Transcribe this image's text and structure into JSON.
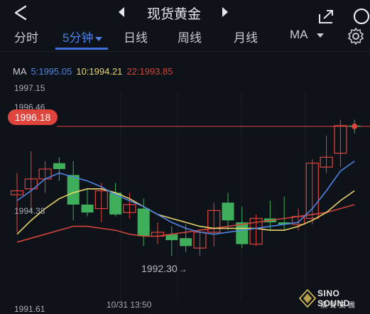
{
  "header": {
    "title": "现货黄金"
  },
  "tabs": [
    {
      "label": "分时"
    },
    {
      "label": "5分钟"
    },
    {
      "label": "日线"
    },
    {
      "label": "周线"
    },
    {
      "label": "月线"
    },
    {
      "label": "MA"
    }
  ],
  "ma_legend": {
    "ma_prefix": "MA",
    "ma5": "5:1995.05",
    "ma10": "10:1994.21",
    "ma22": "22:1993.85"
  },
  "y_axis_labels": {
    "top": "1997.15",
    "upper": "1996.46",
    "mid": "1994.38",
    "bottom": "1991.61"
  },
  "current_price": "1996.18",
  "low_annotation": "1992.30",
  "x_axis_label": "10/31 13:50",
  "logo": {
    "line1": "SINO SOUND",
    "line2": "漢聲集團"
  },
  "colors": {
    "up": "#e0453d",
    "down": "#3fae5a",
    "ma5": "#4f84e0",
    "ma10": "#e8d46a",
    "ma22": "#d0443a",
    "active_tab": "#4f7fe6"
  },
  "chart_data": {
    "type": "candlestick",
    "ylim": [
      1991.61,
      1997.15
    ],
    "candles": [
      {
        "o": 1994.45,
        "h": 1995.0,
        "l": 1993.5,
        "c": 1994.55
      },
      {
        "o": 1994.6,
        "h": 1995.55,
        "l": 1994.0,
        "c": 1994.85
      },
      {
        "o": 1994.85,
        "h": 1995.3,
        "l": 1994.5,
        "c": 1995.1
      },
      {
        "o": 1995.25,
        "h": 1995.4,
        "l": 1994.8,
        "c": 1995.1
      },
      {
        "o": 1994.95,
        "h": 1995.3,
        "l": 1993.8,
        "c": 1994.2
      },
      {
        "o": 1994.2,
        "h": 1994.6,
        "l": 1993.9,
        "c": 1994.0
      },
      {
        "o": 1994.1,
        "h": 1994.75,
        "l": 1993.75,
        "c": 1994.55
      },
      {
        "o": 1994.5,
        "h": 1994.75,
        "l": 1993.9,
        "c": 1993.95
      },
      {
        "o": 1994.0,
        "h": 1994.5,
        "l": 1993.85,
        "c": 1994.2
      },
      {
        "o": 1994.1,
        "h": 1994.35,
        "l": 1993.15,
        "c": 1993.4
      },
      {
        "o": 1993.4,
        "h": 1993.75,
        "l": 1993.2,
        "c": 1993.5
      },
      {
        "o": 1993.45,
        "h": 1993.65,
        "l": 1992.9,
        "c": 1993.3
      },
      {
        "o": 1993.35,
        "h": 1993.7,
        "l": 1993.0,
        "c": 1993.15
      },
      {
        "o": 1993.1,
        "h": 1993.55,
        "l": 1992.9,
        "c": 1993.5
      },
      {
        "o": 1993.5,
        "h": 1994.25,
        "l": 1993.15,
        "c": 1994.05
      },
      {
        "o": 1994.25,
        "h": 1994.5,
        "l": 1993.55,
        "c": 1993.8
      },
      {
        "o": 1993.75,
        "h": 1994.15,
        "l": 1993.1,
        "c": 1993.2
      },
      {
        "o": 1993.2,
        "h": 1993.95,
        "l": 1993.15,
        "c": 1993.85
      },
      {
        "o": 1993.85,
        "h": 1994.3,
        "l": 1993.55,
        "c": 1993.75
      },
      {
        "o": 1993.75,
        "h": 1994.4,
        "l": 1993.55,
        "c": 1993.7
      },
      {
        "o": 1993.7,
        "h": 1994.1,
        "l": 1993.55,
        "c": 1993.9
      },
      {
        "o": 1993.85,
        "h": 1995.35,
        "l": 1993.7,
        "c": 1995.25
      },
      {
        "o": 1995.15,
        "h": 1995.95,
        "l": 1995.0,
        "c": 1995.4
      },
      {
        "o": 1995.5,
        "h": 1996.35,
        "l": 1995.15,
        "c": 1996.2
      },
      {
        "o": 1996.2,
        "h": 1996.35,
        "l": 1996.0,
        "c": 1996.18
      }
    ],
    "ma5": [
      1994.3,
      1994.55,
      1994.85,
      1995.0,
      1994.9,
      1994.8,
      1994.65,
      1994.45,
      1994.3,
      1994.15,
      1993.95,
      1993.75,
      1993.6,
      1993.5,
      1993.45,
      1993.5,
      1993.55,
      1993.6,
      1993.65,
      1993.7,
      1993.75,
      1994.1,
      1994.55,
      1995.05,
      1995.3
    ],
    "ma10": [
      1993.45,
      1993.8,
      1994.1,
      1994.35,
      1994.5,
      1994.6,
      1994.6,
      1994.5,
      1994.35,
      1994.15,
      1993.95,
      1993.85,
      1993.75,
      1993.65,
      1993.6,
      1993.6,
      1993.6,
      1993.6,
      1993.55,
      1993.55,
      1993.65,
      1993.8,
      1994.0,
      1994.3,
      1994.55
    ],
    "ma22": [
      1993.25,
      1993.35,
      1993.45,
      1993.55,
      1993.65,
      1993.65,
      1993.6,
      1993.55,
      1993.45,
      1993.4,
      1993.4,
      1993.45,
      1993.5,
      1993.55,
      1993.6,
      1993.65,
      1993.7,
      1993.75,
      1993.8,
      1993.85,
      1993.9,
      1993.95,
      1994.0,
      1994.1,
      1994.2
    ],
    "current": 1996.18,
    "low": 1992.3
  }
}
